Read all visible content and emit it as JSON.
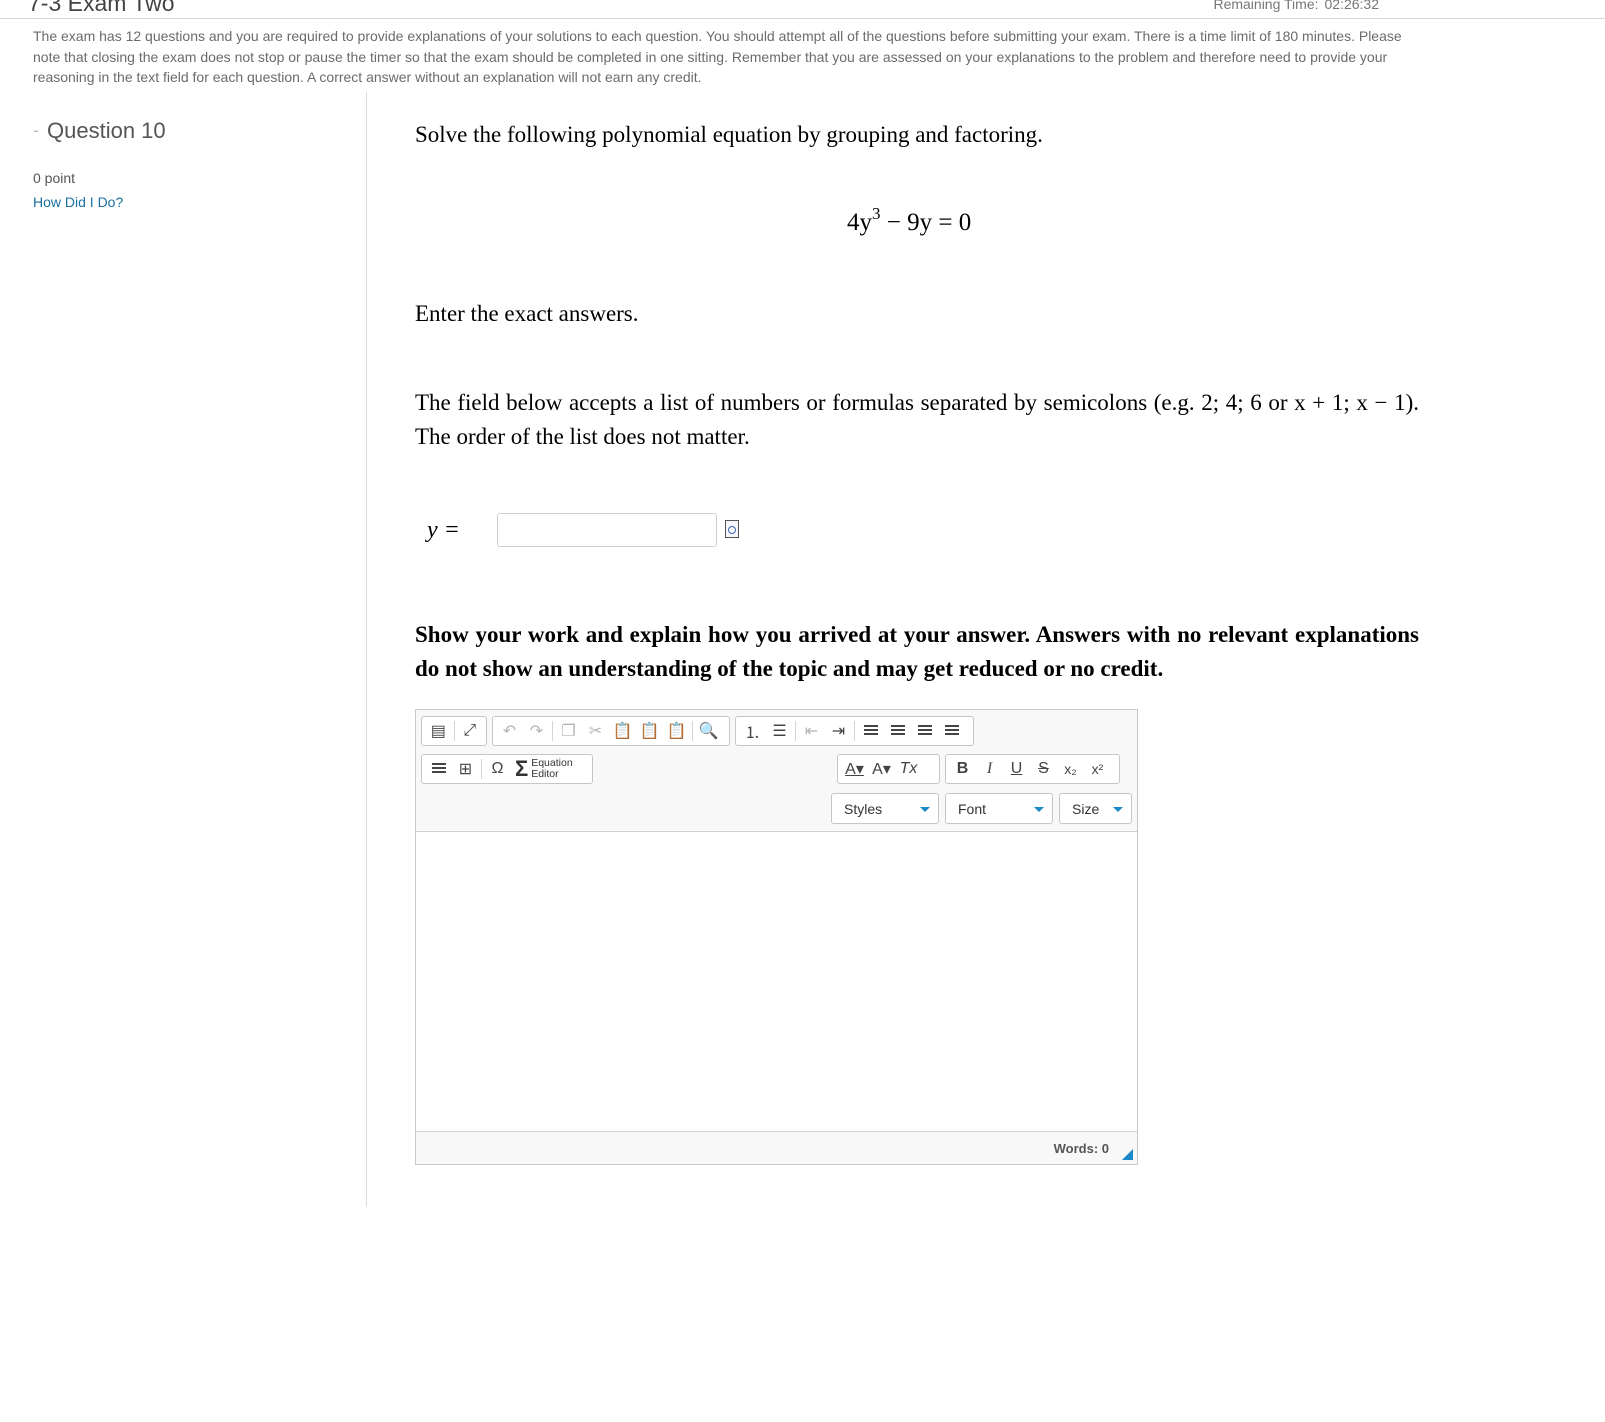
{
  "header": {
    "title": "7-3 Exam Two",
    "remaining_label": "Remaining Time:",
    "remaining_value": "02:26:32"
  },
  "instructions": "The exam has 12 questions and you are required to provide explanations of your solutions to each question. You should attempt all of the questions before submitting your exam. There is a time limit of 180 minutes. Please note that closing the exam does not stop or pause the timer so that the exam should be completed in one sitting. Remember that you are assessed on your explanations to the problem and therefore need to provide your reasoning in the text field for each question. A correct answer without an explanation will not earn any credit.",
  "sidebar": {
    "question_label": "Question 10",
    "points": "0 point",
    "how_did_i_do": "How Did I Do?"
  },
  "question": {
    "prompt": "Solve the following polynomial equation by grouping and factoring.",
    "equation": {
      "coef": "4y",
      "exp": "3",
      "rest": " − 9y = 0"
    },
    "exact": "Enter the exact answers.",
    "field_note": "The field below accepts a list of numbers or formulas separated by semicolons (e.g. 2; 4; 6 or x + 1; x − 1). The order of the list does not matter.",
    "answer_label": "y =",
    "answer_value": "",
    "show_work": "Show your work and explain how you arrived at your answer. Answers with no relevant explanations do not show an understanding of the topic and may get reduced or no credit."
  },
  "editor": {
    "equation_editor_label": [
      "Equation",
      "Editor"
    ],
    "styles_label": "Styles",
    "font_label": "Font",
    "size_label": "Size",
    "words_label": "Words: 0",
    "content": "",
    "toolbar_glyphs": {
      "omega": "Ω",
      "sigma": "Σ",
      "bold": "B",
      "italic": "I",
      "underline": "U",
      "strike": "S",
      "subscript": "x₂",
      "superscript": "x²",
      "text_color": "A▾",
      "bg_color": "A▾",
      "remove_format": "Tx"
    }
  },
  "colors": {
    "link": "#1a6fa0",
    "accent": "#1a88c9",
    "muted_text": "#6b6b6b"
  }
}
